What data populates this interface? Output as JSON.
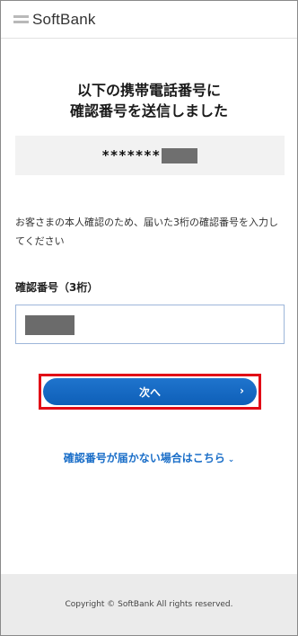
{
  "header": {
    "logo_text": "SoftBank"
  },
  "title": {
    "line1": "以下の携帯電話番号に",
    "line2": "確認番号を送信しました"
  },
  "masked_number": {
    "stars": "*******"
  },
  "description": "お客さまの本人確認のため、届いた3桁の確認番号を入力してください",
  "field": {
    "label": "確認番号（3桁）"
  },
  "next_button": {
    "label": "次へ",
    "chevron": "›"
  },
  "help_link": {
    "label": "確認番号が届かない場合はこちら",
    "chevron": "⌄"
  },
  "footer": {
    "copyright": "Copyright © SoftBank All rights reserved."
  }
}
